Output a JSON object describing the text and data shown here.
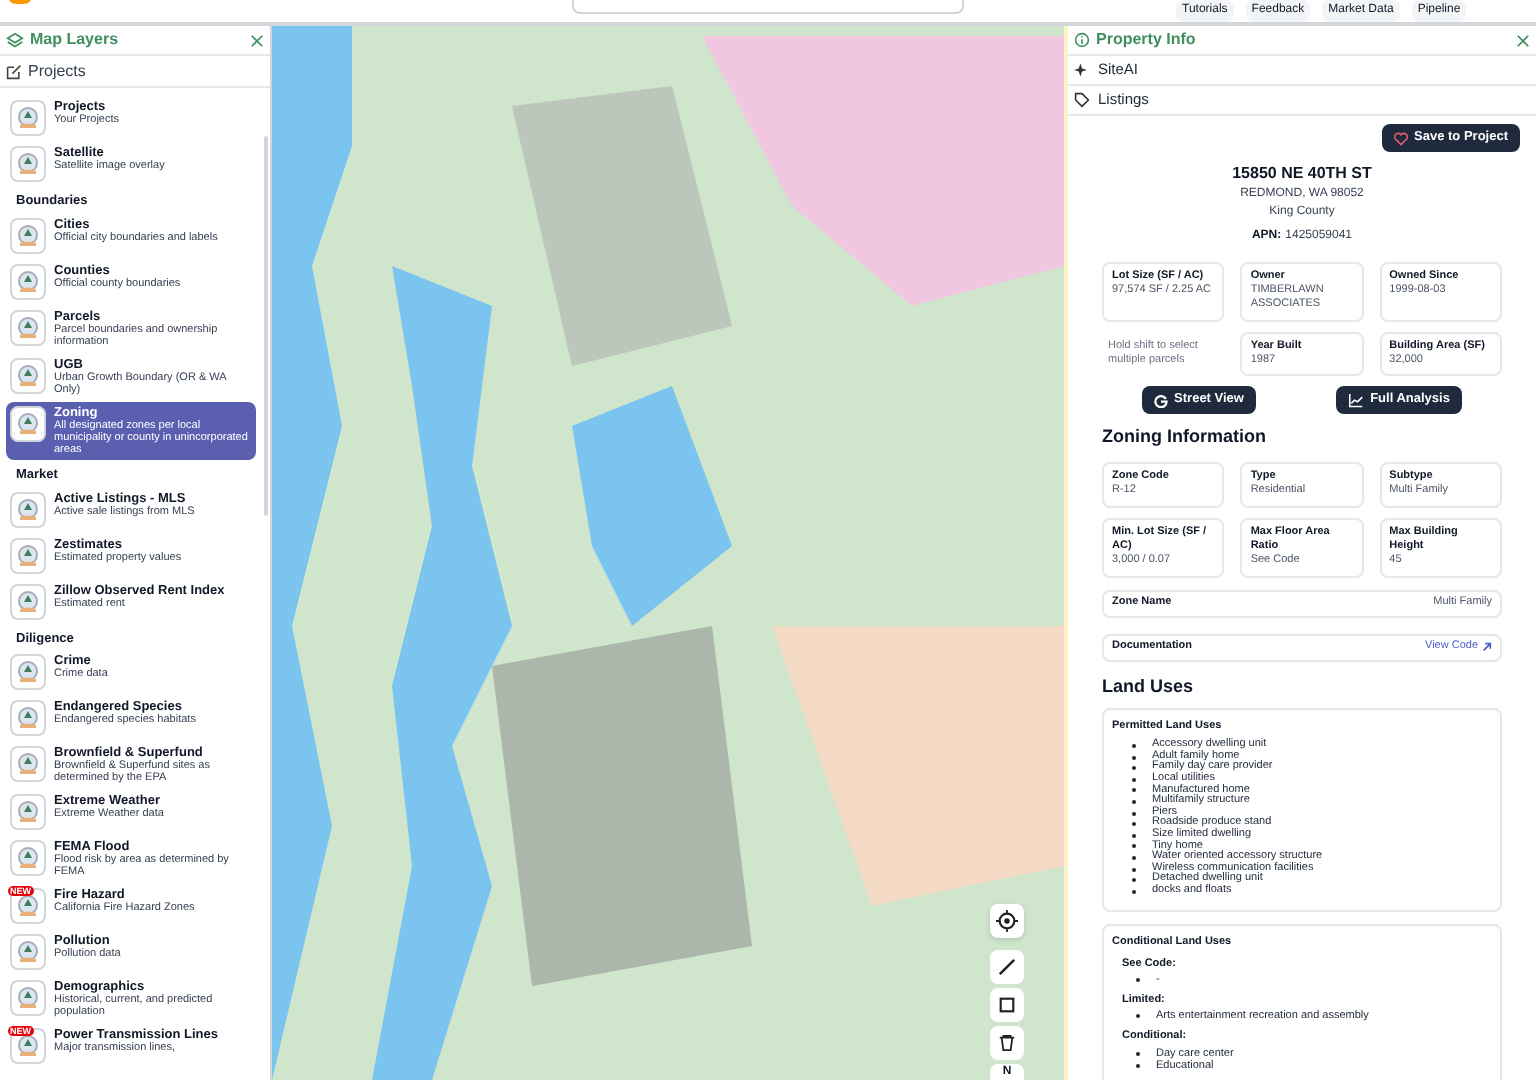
{
  "top_bar": {
    "buttons": [
      "Tutorials",
      "Feedback",
      "Market Data",
      "Pipeline"
    ]
  },
  "layers_panel": {
    "title": "Map Layers",
    "projects_link": "Projects",
    "items": [
      {
        "kind": "layer",
        "title": "Projects",
        "subtitle": "Your Projects",
        "selected": false
      },
      {
        "kind": "layer",
        "title": "Satellite",
        "subtitle": "Satellite image overlay",
        "selected": false
      },
      {
        "kind": "section",
        "title": "Boundaries"
      },
      {
        "kind": "layer",
        "title": "Cities",
        "subtitle": "Official city boundaries and labels",
        "selected": false
      },
      {
        "kind": "layer",
        "title": "Counties",
        "subtitle": "Official county boundaries",
        "selected": false
      },
      {
        "kind": "layer",
        "title": "Parcels",
        "subtitle": "Parcel boundaries and ownership information",
        "selected": false
      },
      {
        "kind": "layer",
        "title": "UGB",
        "subtitle": "Urban Growth Boundary (OR & WA Only)",
        "selected": false
      },
      {
        "kind": "layer",
        "title": "Zoning",
        "subtitle": "All designated zones per local municipality or county in unincorporated areas",
        "selected": true
      },
      {
        "kind": "section",
        "title": "Market"
      },
      {
        "kind": "layer",
        "title": "Active Listings - MLS",
        "subtitle": "Active sale listings from MLS",
        "selected": false
      },
      {
        "kind": "layer",
        "title": "Zestimates",
        "subtitle": "Estimated property values",
        "selected": false
      },
      {
        "kind": "layer",
        "title": "Zillow Observed Rent Index",
        "subtitle": "Estimated rent",
        "selected": false
      },
      {
        "kind": "section",
        "title": "Diligence"
      },
      {
        "kind": "layer",
        "title": "Crime",
        "subtitle": "Crime data",
        "selected": false
      },
      {
        "kind": "layer",
        "title": "Endangered Species",
        "subtitle": "Endangered species habitats",
        "selected": false
      },
      {
        "kind": "layer",
        "title": "Brownfield & Superfund",
        "subtitle": "Brownfield & Superfund sites as determined by the EPA",
        "selected": false
      },
      {
        "kind": "layer",
        "title": "Extreme Weather",
        "subtitle": "Extreme Weather data",
        "selected": false
      },
      {
        "kind": "layer",
        "title": "FEMA Flood",
        "subtitle": "Flood risk by area as determined by FEMA",
        "selected": false
      },
      {
        "kind": "layer",
        "title": "Fire Hazard",
        "subtitle": "California Fire Hazard Zones",
        "selected": false,
        "badge": "NEW"
      },
      {
        "kind": "layer",
        "title": "Pollution",
        "subtitle": "Pollution data",
        "selected": false
      },
      {
        "kind": "layer",
        "title": "Demographics",
        "subtitle": "Historical, current, and predicted population",
        "selected": false
      },
      {
        "kind": "layer",
        "title": "Power Transmission Lines",
        "subtitle": "Major transmission lines,",
        "selected": false,
        "badge": "NEW"
      }
    ]
  },
  "map": {
    "compass": "N"
  },
  "property_panel": {
    "title": "Property Info",
    "tabs": [
      "SiteAI",
      "Listings"
    ],
    "save_button": "Save to Project",
    "address": "15850 NE 40TH ST",
    "city_line": "REDMOND, WA 98052",
    "county": "King County",
    "apn_label": "APN:",
    "apn": "1425059041",
    "facts": [
      {
        "label": "Lot Size (SF / AC)",
        "value": "97,574 SF / 2.25 AC"
      },
      {
        "label": "Owner",
        "value": "TIMBERLAWN ASSOCIATES"
      },
      {
        "label": "Owned Since",
        "value": "1999-08-03"
      },
      {
        "label": "Year Built",
        "value": "1987"
      },
      {
        "label": "Building Area (SF)",
        "value": "32,000"
      }
    ],
    "hint": "Hold shift to select multiple parcels",
    "buttons": [
      "Street View",
      "Full Analysis"
    ],
    "zoning_heading": "Zoning Information",
    "zoning": [
      {
        "label": "Zone Code",
        "value": "R-12"
      },
      {
        "label": "Type",
        "value": "Residential"
      },
      {
        "label": "Subtype",
        "value": "Multi Family"
      },
      {
        "label": "Min. Lot Size (SF / AC)",
        "value": "3,000 / 0.07"
      },
      {
        "label": "Max Floor Area Ratio",
        "value": "See Code"
      },
      {
        "label": "Max Building Height",
        "value": "45"
      }
    ],
    "zone_name": {
      "label": "Zone Name",
      "value": "Multi Family"
    },
    "documentation": {
      "label": "Documentation",
      "link": "View Code"
    },
    "land_uses_heading": "Land Uses",
    "permitted": {
      "title": "Permitted Land Uses",
      "items": [
        "Accessory dwelling unit",
        "Adult family home",
        "Family day care provider",
        "Local utilities",
        "Manufactured home",
        "Multifamily structure",
        "Piers",
        "Roadside produce stand",
        "Size limited dwelling",
        "Tiny home",
        "Water oriented accessory structure",
        "Wireless communication facilities",
        "Detached dwelling unit",
        "docks and floats"
      ]
    },
    "conditional": {
      "title": "Conditional Land Uses",
      "groups": [
        {
          "title": "See Code:",
          "items": [
            "-"
          ]
        },
        {
          "title": "Limited:",
          "items": [
            "Arts entertainment recreation and assembly"
          ]
        },
        {
          "title": "Conditional:",
          "items": [
            "Day care center",
            "Educational"
          ]
        }
      ]
    }
  }
}
